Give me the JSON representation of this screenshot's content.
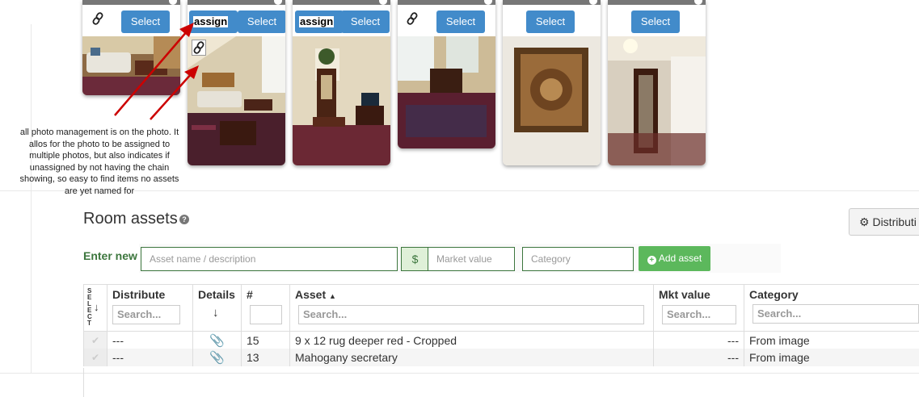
{
  "photo_strip": {
    "cards": [
      {
        "select_label": "Select",
        "assign_label": "",
        "has_chain": true,
        "chain_in_photo": false,
        "photo": "living-room"
      },
      {
        "select_label": "Select",
        "assign_label": "assign",
        "has_chain": true,
        "chain_in_photo": true,
        "photo": "living-room-wide"
      },
      {
        "select_label": "Select",
        "assign_label": "assign",
        "has_chain": false,
        "chain_in_photo": false,
        "photo": "secretary-room"
      },
      {
        "select_label": "Select",
        "assign_label": "",
        "has_chain": true,
        "chain_in_photo": false,
        "photo": "rug-room"
      },
      {
        "select_label": "Select",
        "assign_label": "",
        "has_chain": false,
        "chain_in_photo": false,
        "photo": "tapestry"
      },
      {
        "select_label": "Select",
        "assign_label": "",
        "has_chain": false,
        "chain_in_photo": false,
        "photo": "mirror-hall"
      }
    ]
  },
  "annotation": {
    "text": "all photo management is on the photo.  It allos for the photo to be assigned to multiple photos, but also indicates if unassigned by not having the chain showing, so easy to find items no assets are yet named for"
  },
  "assets": {
    "title": "Room assets",
    "help_icon": "?",
    "distribute_button": "Distributi",
    "enter_new_label": "Enter new",
    "name_placeholder": "Asset name / description",
    "currency_symbol": "$",
    "market_placeholder": "Market value",
    "category_placeholder": "Category",
    "add_button": "Add asset"
  },
  "table": {
    "select_header": "SELECT",
    "columns": {
      "distribute": "Distribute",
      "details": "Details",
      "number": "#",
      "asset": "Asset",
      "mkt": "Mkt value",
      "category": "Category"
    },
    "filter_placeholder": "Search...",
    "rows": [
      {
        "distribute": "---",
        "number": "15",
        "asset": "9 x 12 rug deeper red - Cropped",
        "mkt": "---",
        "category": "From image"
      },
      {
        "distribute": "---",
        "number": "13",
        "asset": "Mahogany secretary",
        "mkt": "---",
        "category": "From image"
      }
    ]
  },
  "colors": {
    "primary": "#428bca",
    "success": "#5cb85c",
    "success_text": "#3c763d",
    "annotation_arrow": "#cc0000"
  }
}
